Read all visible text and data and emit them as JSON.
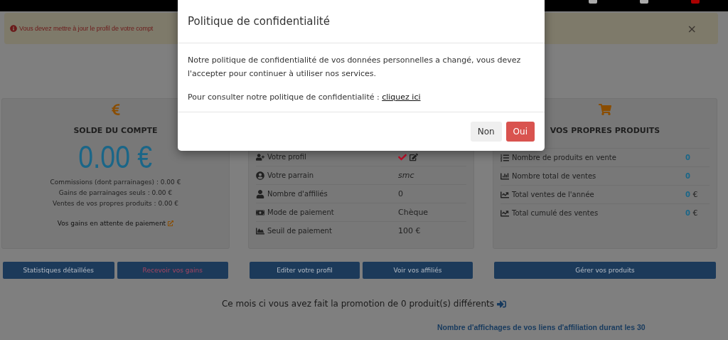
{
  "alert": {
    "text": "Vous devez mettre à jour le profil de votre compt",
    "dismiss": "×"
  },
  "modal": {
    "title": "Politique de confidentialité",
    "body": "Notre politique de confidentialité de vos données personnelles a changé, vous devez l'accepter pour continuer à utiliser nos services.",
    "link_prefix": "Pour consulter notre politique de confidentialité :",
    "link": "cliquez ici",
    "buttons": [
      {
        "label": "Non",
        "kind": "default"
      },
      {
        "label": "Oui",
        "kind": "danger"
      }
    ]
  },
  "balance_card": {
    "title": "SOLDE DU COMPTE",
    "amount": "0.00 €",
    "lines": [
      "Commissions (dont parrainages) : 0.00 €",
      "Gains de parrainages seuls : 0.00 €",
      "Ventes de vos propres produits : 0.00 €"
    ],
    "pending_link": "Vos gains en attente de paiement"
  },
  "profile_card": {
    "rows": [
      {
        "label": "Votre profil",
        "kind": "status",
        "complete": true
      },
      {
        "label": "Votre parrain",
        "kind": "name",
        "value": "smc"
      },
      {
        "label": "Nombre d'affiliés",
        "kind": "text",
        "value": "0"
      },
      {
        "label": "Mode de paiement",
        "kind": "text",
        "value": "Chèque"
      },
      {
        "label": "Seuil de paiement",
        "kind": "text",
        "value": "100 €"
      }
    ]
  },
  "products_card": {
    "title": "VOS PROPRES PRODUITS",
    "rows": [
      {
        "label": "Nombre de produits en vente",
        "value": "0"
      },
      {
        "label": "Nombre total de ventes",
        "value": "0"
      },
      {
        "label": "Total ventes de l'année",
        "value": "0",
        "unit": "€"
      },
      {
        "label": "Total cumulé des ventes",
        "value": "0",
        "unit": "€"
      }
    ]
  },
  "button_groups": [
    [
      {
        "label": "Statistiques détaillées",
        "kind": "normal"
      },
      {
        "label": "Recevoir vos gains",
        "kind": "alert"
      }
    ],
    [
      {
        "label": "Editer votre profil",
        "kind": "normal"
      },
      {
        "label": "Voir vos affiliés",
        "kind": "normal"
      }
    ],
    [
      {
        "label": "Gérer vos produits",
        "kind": "normal"
      }
    ]
  ],
  "promotion": "Ce mois ci vous avez fait la promotion de 0 produit(s) différents",
  "stats_heading": "Nombre d'affichages de vos liens d'affiliation durant les 30"
}
